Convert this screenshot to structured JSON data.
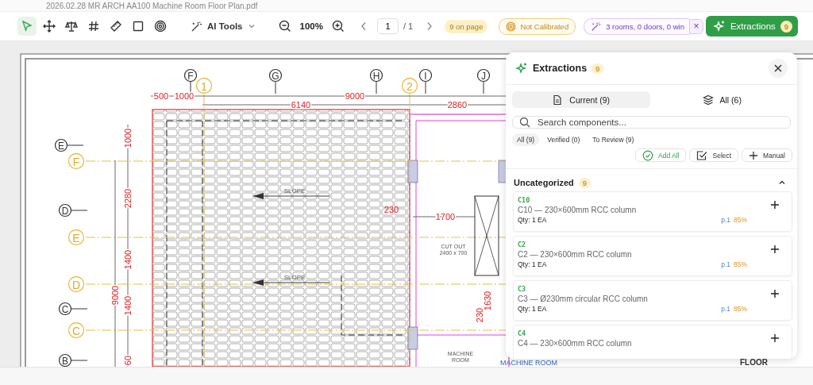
{
  "file": {
    "name": "2026.02.28 MR ARCH AA100 Machine Room Floor Plan.pdf"
  },
  "toolbar": {
    "tools": [
      {
        "kind": "pointer",
        "selected": true
      },
      {
        "kind": "pan",
        "selected": false
      },
      {
        "kind": "scale",
        "selected": false
      },
      {
        "kind": "grid",
        "selected": false
      },
      {
        "kind": "ruler",
        "selected": false
      },
      {
        "kind": "rectangle",
        "selected": false
      },
      {
        "kind": "target",
        "selected": false
      }
    ],
    "ai_tools": "AI Tools",
    "zoom": "100%",
    "page_value": "1",
    "page_total": "/ 1",
    "on_page": "9 on page",
    "calibration": "Not Calibrated",
    "detection": "3 rooms, 0 doors, 0 win",
    "dismiss": "×",
    "extractions_button": {
      "label": "Extractions",
      "count": "9"
    }
  },
  "plan": {
    "top_letter_grid": [
      "F",
      "G",
      "H",
      "I",
      "J"
    ],
    "numbered_grid": [
      "1",
      "2"
    ],
    "left_letter_grid": [
      "E",
      "D",
      "C",
      "B"
    ],
    "left_yellow_grid": [
      "F",
      "E",
      "D",
      "C"
    ],
    "top_dimensions": [
      "500",
      "1000",
      "9000"
    ],
    "second_dimensions": [
      "6140",
      "2860"
    ],
    "left_dimensions": [
      "1000",
      "2280",
      "1400",
      "1400",
      "60"
    ],
    "overall_dimension": "9000",
    "slope_labels": [
      "SLOPE",
      "SLOPE"
    ],
    "inner_dimensions": [
      "230",
      "1700"
    ],
    "cutout_label": [
      "CUT OUT",
      "2400 x 700"
    ],
    "vertical_dimensions": [
      "230",
      "1630"
    ],
    "room_label": [
      "MACHINE",
      "ROOM"
    ],
    "room_tag": "MACHINE ROOM",
    "floor_label": "FLOOR"
  },
  "panel": {
    "title": "Extractions",
    "count": "9",
    "tabs": [
      {
        "label": "Current (9)",
        "selected": true
      },
      {
        "label": "All (6)",
        "selected": false
      }
    ],
    "search": {
      "placeholder": "Search components..."
    },
    "filters": [
      {
        "label": "All (9)",
        "selected": true
      },
      {
        "label": "Verified (0)",
        "selected": false
      },
      {
        "label": "To Review (9)",
        "selected": false
      }
    ],
    "actions": [
      {
        "kind": "add-all",
        "label": "Add All"
      },
      {
        "kind": "select",
        "label": "Select"
      },
      {
        "kind": "manual",
        "label": "Manual"
      }
    ],
    "group": {
      "title": "Uncategorized",
      "count": "9",
      "expanded": true
    },
    "items": [
      {
        "code": "C10",
        "description": "C10 — 230×600mm RCC column",
        "qty": "Qty: 1 EA",
        "page": "p.1",
        "confidence": "85%"
      },
      {
        "code": "C2",
        "description": "C2 — 230×600mm RCC column",
        "qty": "Qty: 1 EA",
        "page": "p.1",
        "confidence": "85%"
      },
      {
        "code": "C3",
        "description": "C3 — Ø230mm circular RCC column",
        "qty": "Qty: 1 EA",
        "page": "p.1",
        "confidence": "85%"
      },
      {
        "code": "C4",
        "description": "C4 — 230×600mm RCC column"
      }
    ]
  }
}
